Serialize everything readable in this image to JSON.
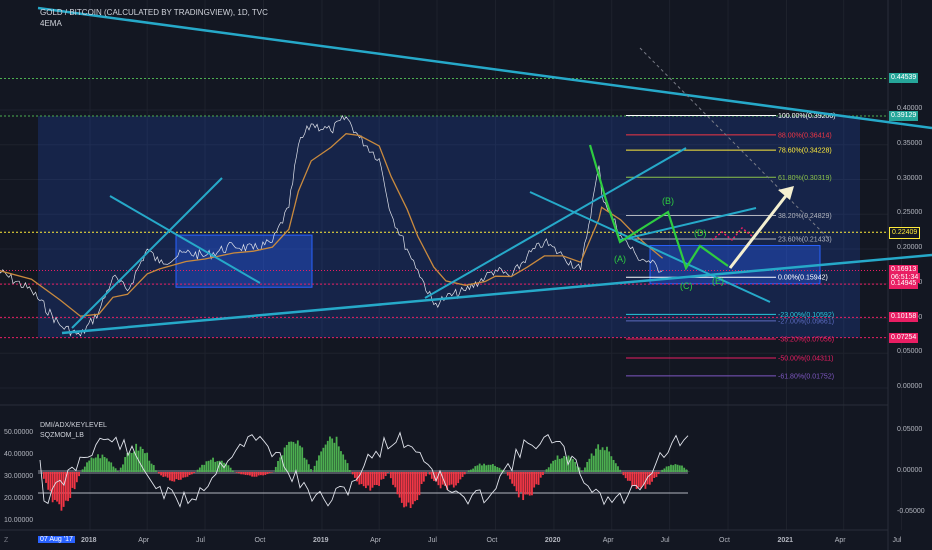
{
  "header": {
    "title": "GOLD / BITCOIN (CALCULATED BY TRADINGVIEW), 1D, TVC",
    "indicator": "4EMA"
  },
  "price_tags": [
    {
      "label": "0.44539",
      "color": "#26a69a",
      "value": 0.44539
    },
    {
      "label": "0.39129",
      "color": "#26a69a",
      "value": 0.39129
    },
    {
      "label": "0.22409",
      "color": "#131722",
      "value": 0.22409
    },
    {
      "label": "0.16913",
      "color": "#e91e63",
      "value": 0.16913
    },
    {
      "label": "06:51:34",
      "color": "#e91e63",
      "value": 0.1585
    },
    {
      "label": "0.14945",
      "color": "#e91e63",
      "value": 0.14945
    },
    {
      "label": "0.10158",
      "color": "#e91e63",
      "value": 0.10158
    },
    {
      "label": "0.07254",
      "color": "#e91e63",
      "value": 0.07254
    }
  ],
  "fib_levels": [
    {
      "label": "100.00%(0.39206)",
      "color": "#ffffff",
      "value": 0.39206
    },
    {
      "label": "88.00%(0.36414)",
      "color": "#f23645",
      "value": 0.36414
    },
    {
      "label": "78.60%(0.34228)",
      "color": "#ffeb3b",
      "value": 0.34228
    },
    {
      "label": "61.80%(0.30319)",
      "color": "#8bc34a",
      "value": 0.30319
    },
    {
      "label": "38.20%(0.24829)",
      "color": "#b2b5be",
      "value": 0.24829
    },
    {
      "label": "23.60%(0.21433)",
      "color": "#b2b5be",
      "value": 0.21433
    },
    {
      "label": "0.00%(0.15942)",
      "color": "#ffffff",
      "value": 0.15942
    },
    {
      "label": "-23.00%(0.10592)",
      "color": "#26c6da",
      "value": 0.10592
    },
    {
      "label": "-27.00%(0.09661)",
      "color": "#5c6bc0",
      "value": 0.09661
    },
    {
      "label": "-38.20%(0.07056)",
      "color": "#e91e63",
      "value": 0.07056
    },
    {
      "label": "-50.00%(0.04311)",
      "color": "#e91e63",
      "value": 0.04311
    },
    {
      "label": "-61.80%(0.01752)",
      "color": "#7e57c2",
      "value": 0.01752
    }
  ],
  "wave_labels": [
    "(A)",
    "(B)",
    "(C)",
    "(D)",
    "(E)"
  ],
  "panel": {
    "title": "DMI/ADX/KEYLEVEL",
    "subtitle": "SQZMOM_LB",
    "corner": "Z",
    "left_axis": [
      "50.00000",
      "40.00000",
      "30.00000",
      "20.00000",
      "10.00000"
    ],
    "right_axis": [
      "0.05000",
      "0.00000",
      "-0.05000"
    ]
  },
  "x_labels": [
    "2018",
    "Apr",
    "Jul",
    "Oct",
    "2019",
    "Apr",
    "Jul",
    "Oct",
    "2020",
    "Apr",
    "Jul",
    "Oct",
    "2021",
    "Apr",
    "Jul"
  ],
  "x_badge": "07 Aug '17",
  "chart_data": [
    {
      "type": "line",
      "title": "GOLD / BITCOIN (CALCULATED BY TRADINGVIEW), 1D, TVC",
      "ylim": [
        -0.015,
        0.415
      ],
      "y_ticks": [
        "0.40000",
        "0.35000",
        "0.30000",
        "0.25000",
        "0.20000",
        "0.15000",
        "0.10000",
        "0.05000",
        "0.00000"
      ],
      "y_tick_values": [
        0.4,
        0.35,
        0.3,
        0.25,
        0.2,
        0.15,
        0.1,
        0.05,
        0.0
      ],
      "x_tick_labels": [
        "2018",
        "Apr",
        "Jul",
        "Oct",
        "2019",
        "Apr",
        "Jul",
        "Oct",
        "2020",
        "Apr",
        "Jul",
        "Oct",
        "2021",
        "Apr",
        "Jul"
      ],
      "x": [
        "2017-08-07",
        "2017-10-01",
        "2017-11-15",
        "2017-12-17",
        "2018-01-15",
        "2018-02-06",
        "2018-03-01",
        "2018-04-01",
        "2018-04-20",
        "2018-06-01",
        "2018-07-01",
        "2018-08-15",
        "2018-09-15",
        "2018-10-15",
        "2018-11-10",
        "2018-11-25",
        "2018-12-15",
        "2019-01-15",
        "2019-02-08",
        "2019-03-01",
        "2019-04-01",
        "2019-04-20",
        "2019-05-15",
        "2019-06-01",
        "2019-06-26",
        "2019-07-15",
        "2019-08-15",
        "2019-09-15",
        "2019-10-01",
        "2019-10-26",
        "2019-11-20",
        "2019-12-17",
        "2020-01-15",
        "2020-02-12",
        "2020-03-12",
        "2020-03-16",
        "2020-04-15",
        "2020-05-10",
        "2020-06-01",
        "2020-06-20"
      ],
      "series": [
        {
          "values": [
            0.17,
            0.14,
            0.09,
            0.075,
            0.11,
            0.16,
            0.14,
            0.2,
            0.18,
            0.195,
            0.19,
            0.205,
            0.2,
            0.21,
            0.26,
            0.35,
            0.38,
            0.37,
            0.39,
            0.36,
            0.33,
            0.25,
            0.2,
            0.17,
            0.12,
            0.13,
            0.14,
            0.16,
            0.17,
            0.16,
            0.19,
            0.21,
            0.19,
            0.17,
            0.32,
            0.28,
            0.22,
            0.19,
            0.18,
            0.169
          ]
        }
      ],
      "annotations": [
        "(A)",
        "(B)",
        "(C)",
        "(D)",
        "(E)"
      ]
    },
    {
      "type": "bar",
      "title": "DMI/ADX/KEYLEVEL",
      "subtitle": "SQZMOM_LB",
      "ylim": [
        -0.075,
        0.065
      ],
      "y_ticks": [
        "0.05000",
        "0.00000",
        "-0.05000"
      ],
      "left_axis_ticks": [
        "50.00000",
        "40.00000",
        "30.00000",
        "20.00000",
        "10.00000"
      ],
      "x": [
        "2017-09",
        "2017-11",
        "2018-01",
        "2018-03",
        "2018-05",
        "2018-07",
        "2018-09",
        "2018-11",
        "2019-01",
        "2019-03",
        "2019-05",
        "2019-07",
        "2019-09",
        "2019-11",
        "2020-01",
        "2020-03",
        "2020-05",
        "2020-07"
      ],
      "values": [
        -0.03,
        -0.04,
        0.02,
        0.03,
        -0.01,
        0.015,
        -0.005,
        0.035,
        0.045,
        -0.02,
        -0.04,
        -0.02,
        0.01,
        -0.03,
        0.02,
        0.03,
        -0.02,
        0.01
      ]
    }
  ]
}
